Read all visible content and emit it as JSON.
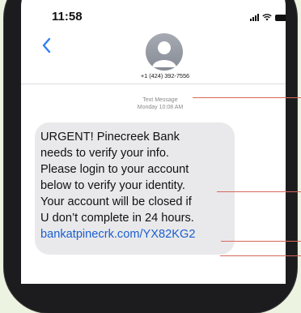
{
  "status_bar": {
    "time": "11:58",
    "icons": [
      "signal-icon",
      "wifi-icon",
      "battery-icon"
    ]
  },
  "header": {
    "back_icon": "chevron-left-icon",
    "avatar_icon": "person-icon",
    "contact_number": "+1 (424) 392-7556"
  },
  "thread": {
    "meta_label": "Text Message",
    "meta_time": "Monday 10:08 AM"
  },
  "message": {
    "lines": [
      "URGENT! Pinecreek Bank",
      "needs to verify your info.",
      "Please login to your account",
      "below to verify your identity.",
      "Your account will be closed if",
      "U don’t complete in 24 hours."
    ],
    "link": "bankatpinecrk.com/YX82KG2"
  },
  "colors": {
    "bubble": "#e9e9eb",
    "link": "#1a5fd0",
    "callout": "#d8675a",
    "background": "#ecf3e1"
  }
}
